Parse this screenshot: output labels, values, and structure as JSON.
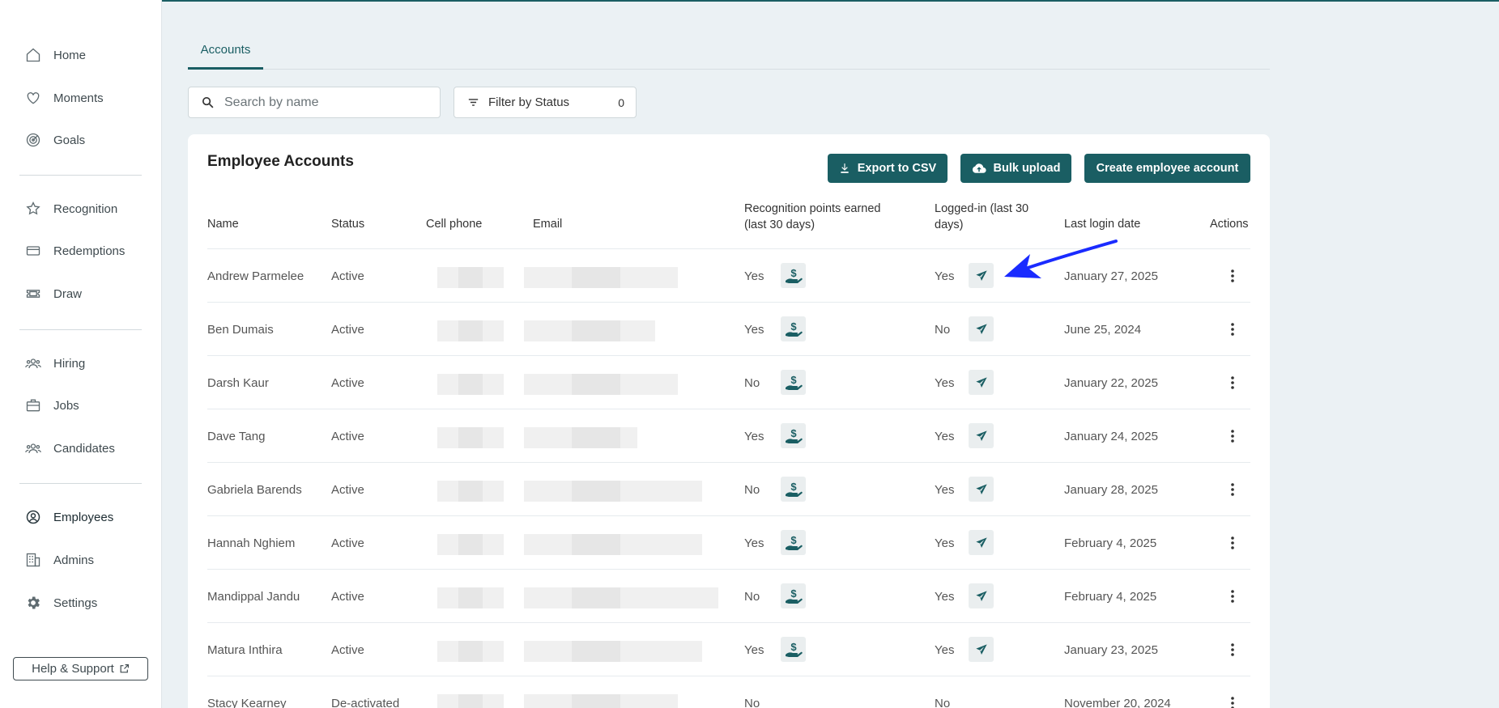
{
  "sidebar": {
    "items": [
      {
        "label": "Home",
        "icon": "home-icon"
      },
      {
        "label": "Moments",
        "icon": "heart-icon"
      },
      {
        "label": "Goals",
        "icon": "target-icon"
      },
      {
        "label": "Recognition",
        "icon": "star-badge-icon"
      },
      {
        "label": "Redemptions",
        "icon": "credit-card-icon"
      },
      {
        "label": "Draw",
        "icon": "ticket-icon"
      },
      {
        "label": "Hiring",
        "icon": "people-icon"
      },
      {
        "label": "Jobs",
        "icon": "briefcase-icon"
      },
      {
        "label": "Candidates",
        "icon": "people-icon"
      },
      {
        "label": "Employees",
        "icon": "user-circle-icon"
      },
      {
        "label": "Admins",
        "icon": "building-icon"
      },
      {
        "label": "Settings",
        "icon": "gear-icon"
      }
    ],
    "help_label": "Help & Support"
  },
  "tabs": [
    {
      "label": "Accounts"
    }
  ],
  "search": {
    "placeholder": "Search by name"
  },
  "filter": {
    "label": "Filter by Status",
    "count": "0"
  },
  "card": {
    "title": "Employee Accounts",
    "export_label": "Export to CSV",
    "bulk_label": "Bulk upload",
    "create_label": "Create employee account"
  },
  "table": {
    "headers": {
      "name": "Name",
      "status": "Status",
      "cell_phone": "Cell phone",
      "email": "Email",
      "recognition_line1": "Recognition points earned",
      "recognition_line2": "(last 30 days)",
      "logged_line1": "Logged-in (last 30",
      "logged_line2": "days)",
      "last_login": "Last login date",
      "actions": "Actions"
    },
    "rows": [
      {
        "name": "Andrew Parmelee",
        "status": "Active",
        "recognition": "Yes",
        "logged_in": "Yes",
        "last_login": "January 27, 2025"
      },
      {
        "name": "Ben Dumais",
        "status": "Active",
        "recognition": "Yes",
        "logged_in": "No",
        "last_login": "June 25, 2024"
      },
      {
        "name": "Darsh Kaur",
        "status": "Active",
        "recognition": "No",
        "logged_in": "Yes",
        "last_login": "January 22, 2025"
      },
      {
        "name": "Dave Tang",
        "status": "Active",
        "recognition": "Yes",
        "logged_in": "Yes",
        "last_login": "January 24, 2025"
      },
      {
        "name": "Gabriela Barends",
        "status": "Active",
        "recognition": "No",
        "logged_in": "Yes",
        "last_login": "January 28, 2025"
      },
      {
        "name": "Hannah Nghiem",
        "status": "Active",
        "recognition": "Yes",
        "logged_in": "Yes",
        "last_login": "February 4, 2025"
      },
      {
        "name": "Mandippal Jandu",
        "status": "Active",
        "recognition": "No",
        "logged_in": "Yes",
        "last_login": "February 4, 2025"
      },
      {
        "name": "Matura Inthira",
        "status": "Active",
        "recognition": "Yes",
        "logged_in": "Yes",
        "last_login": "January 23, 2025"
      },
      {
        "name": "Stacy Kearney",
        "status": "De-activated",
        "recognition": "No",
        "logged_in": "No",
        "last_login": "November 20, 2024"
      }
    ]
  },
  "colors": {
    "accent": "#1a5e63",
    "annotation_arrow": "#1a2bff"
  }
}
